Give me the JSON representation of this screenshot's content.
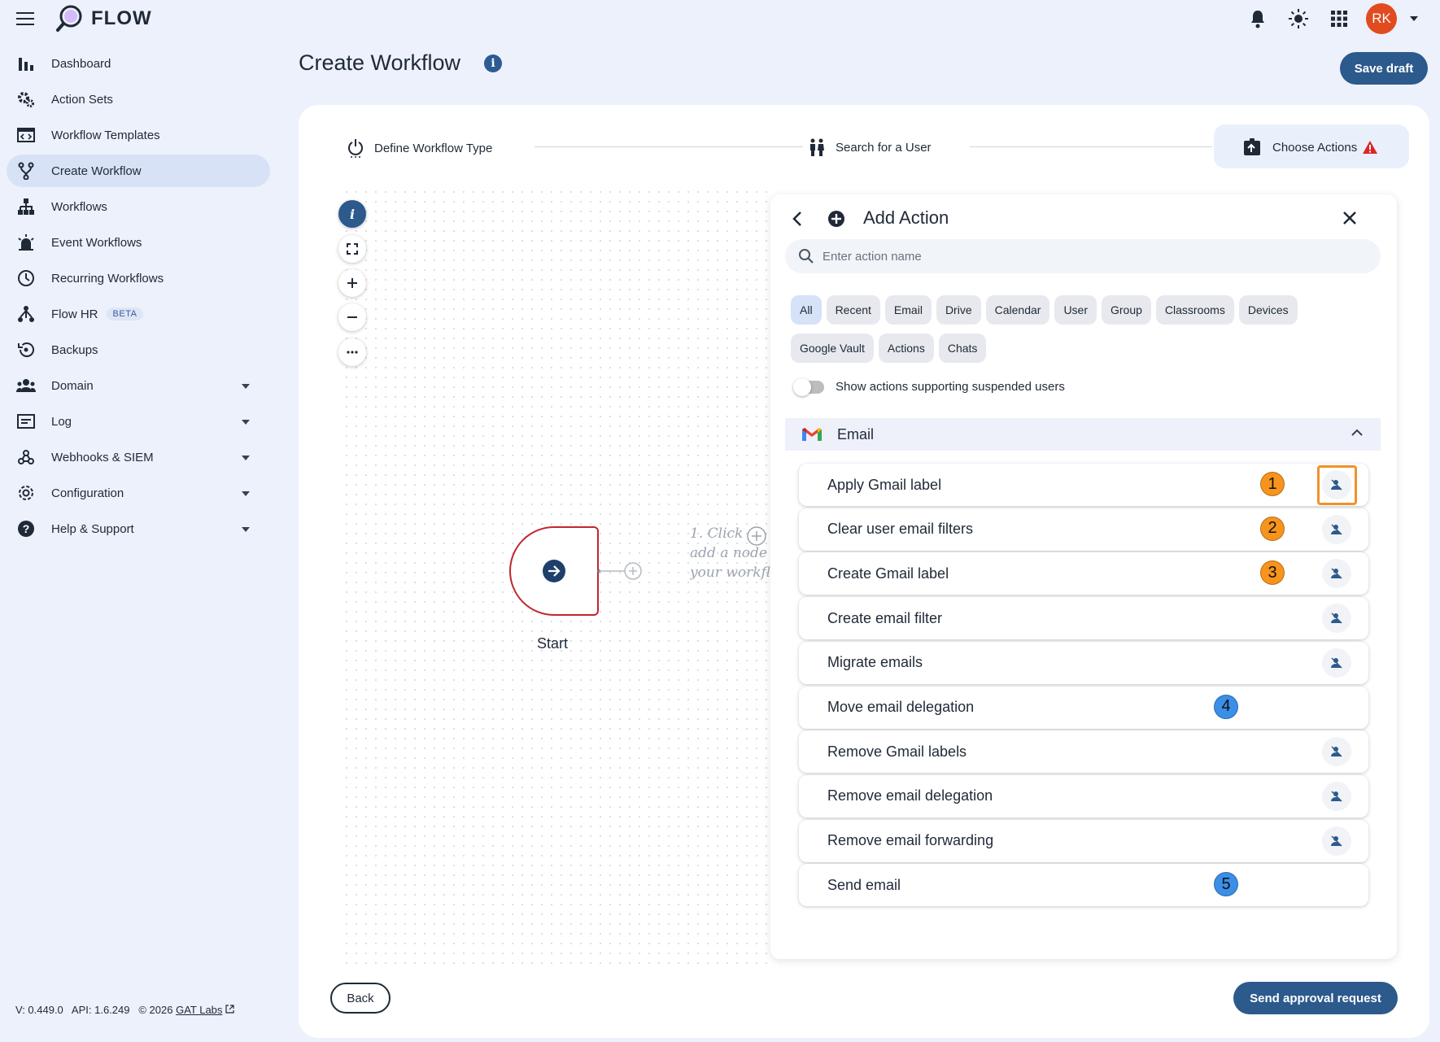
{
  "app": {
    "name": "FLOW"
  },
  "user": {
    "initials": "RK"
  },
  "sidebar": {
    "items": [
      {
        "label": "Dashboard",
        "icon": "bar-chart-icon"
      },
      {
        "label": "Action Sets",
        "icon": "gears-icon"
      },
      {
        "label": "Workflow Templates",
        "icon": "template-icon"
      },
      {
        "label": "Create Workflow",
        "icon": "fork-icon",
        "active": true
      },
      {
        "label": "Workflows",
        "icon": "hierarchy-icon"
      },
      {
        "label": "Event Workflows",
        "icon": "alarm-icon"
      },
      {
        "label": "Recurring Workflows",
        "icon": "clock-icon"
      },
      {
        "label": "Flow HR",
        "icon": "people-tree-icon",
        "badge": "BETA"
      },
      {
        "label": "Backups",
        "icon": "backup-icon"
      },
      {
        "label": "Domain",
        "icon": "group-icon",
        "expandable": true
      },
      {
        "label": "Log",
        "icon": "log-icon",
        "expandable": true
      },
      {
        "label": "Webhooks & SIEM",
        "icon": "webhook-icon",
        "expandable": true
      },
      {
        "label": "Configuration",
        "icon": "gear-icon",
        "expandable": true
      },
      {
        "label": "Help & Support",
        "icon": "help-icon",
        "expandable": true
      }
    ]
  },
  "footer": {
    "version": "V: 0.449.0",
    "api": "API: 1.6.249",
    "copyright": "© 2026",
    "company": "GAT Labs"
  },
  "header": {
    "title": "Create Workflow",
    "save_draft": "Save draft"
  },
  "stepper": {
    "steps": [
      {
        "label": "Define Workflow Type"
      },
      {
        "label": "Search for a User"
      },
      {
        "label": "Choose Actions",
        "active": true
      }
    ]
  },
  "canvas": {
    "start_label": "Start",
    "hint_lines": [
      "1. Click",
      "add a node",
      "your workfl"
    ]
  },
  "panel": {
    "title": "Add Action",
    "search_placeholder": "Enter action name",
    "chips": [
      "All",
      "Recent",
      "Email",
      "Drive",
      "Calendar",
      "User",
      "Group",
      "Classrooms",
      "Devices",
      "Google Vault",
      "Actions",
      "Chats"
    ],
    "active_chip": "All",
    "toggle_label": "Show actions supporting suspended users",
    "section": "Email",
    "actions": [
      {
        "label": "Apply Gmail label",
        "badge": "1",
        "badge_color": "#f7941d",
        "suspended_support": true,
        "highlight": true
      },
      {
        "label": "Clear user email filters",
        "badge": "2",
        "badge_color": "#f7941d",
        "suspended_support": true
      },
      {
        "label": "Create Gmail label",
        "badge": "3",
        "badge_color": "#f7941d",
        "suspended_support": true
      },
      {
        "label": "Create email filter",
        "badge": "",
        "suspended_support": true
      },
      {
        "label": "Migrate emails",
        "badge": "",
        "suspended_support": true
      },
      {
        "label": "Move email delegation",
        "badge": "4",
        "badge_color": "#3b8fe8",
        "suspended_support": false
      },
      {
        "label": "Remove Gmail labels",
        "badge": "",
        "suspended_support": true
      },
      {
        "label": "Remove email delegation",
        "badge": "",
        "suspended_support": true
      },
      {
        "label": "Remove email forwarding",
        "badge": "",
        "suspended_support": true
      },
      {
        "label": "Send email",
        "badge": "5",
        "badge_color": "#3b8fe8",
        "suspended_support": false
      }
    ]
  },
  "buttons": {
    "back": "Back",
    "send_approval": "Send approval request"
  },
  "colors": {
    "primary": "#2d5a8c",
    "accent_orange": "#f7941d",
    "accent_blue": "#3b8fe8",
    "start_border": "#c0262d",
    "avatar": "#e24a1f"
  }
}
